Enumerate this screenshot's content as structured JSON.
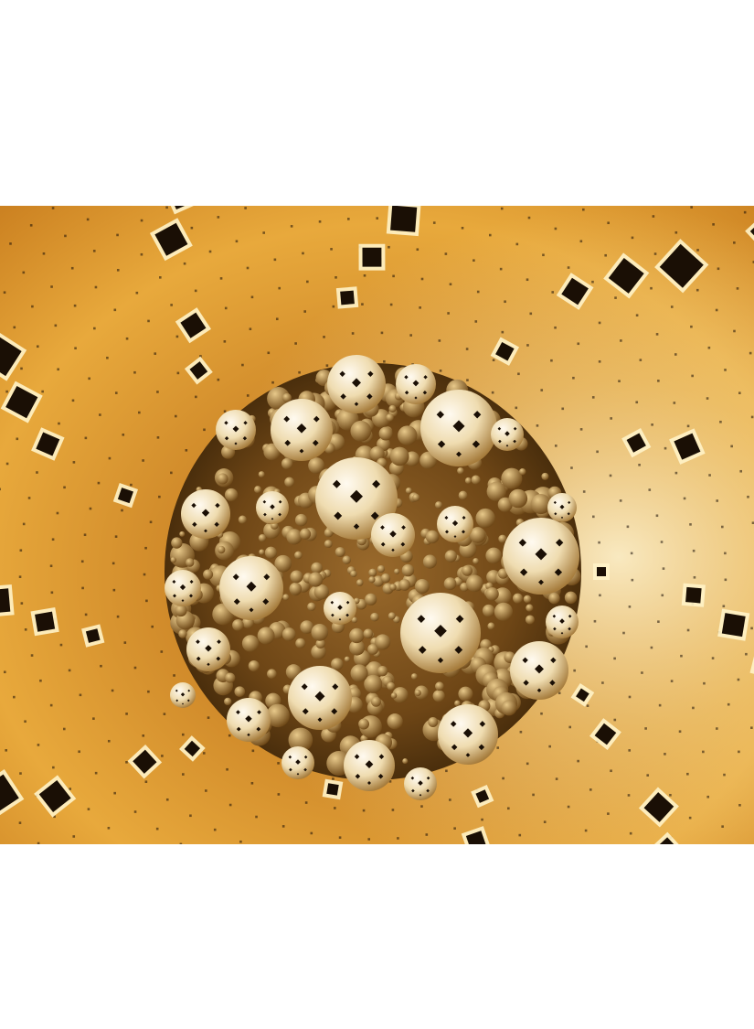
{
  "page": {
    "background": "#ffffff"
  },
  "artwork": {
    "subject": "fractal-sphere-cluster",
    "palette": {
      "wall_light": "#f7e3b0",
      "wall_mid": "#e8a93c",
      "wall_dark": "#b86a12",
      "core_dark": "#5a3a12",
      "core_mid": "#8a5a20",
      "sphere_light": "#fbf3de",
      "sphere_shade": "#c9a76a",
      "hole": "#1a0f05",
      "frame_light": "#fff3c8"
    }
  }
}
